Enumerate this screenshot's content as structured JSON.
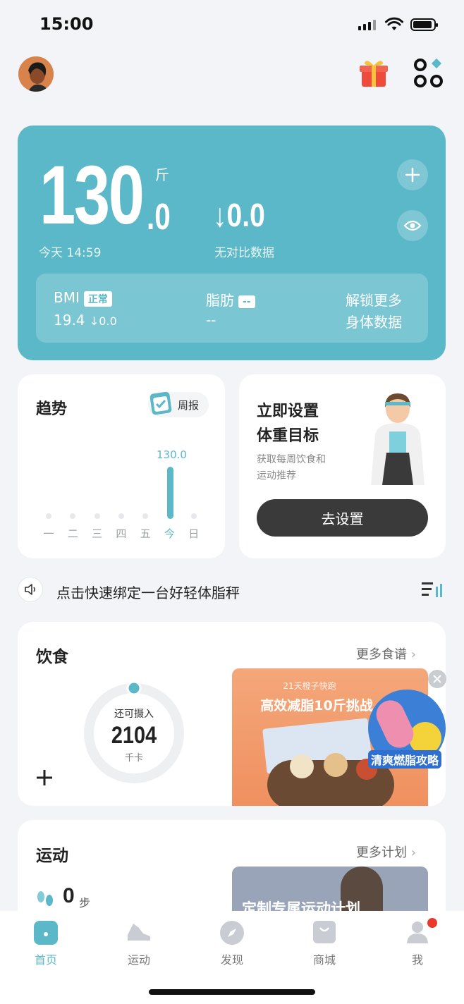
{
  "status": {
    "time": "15:00"
  },
  "weight": {
    "integer": "130",
    "decimal": ".0",
    "unit": "斤",
    "time": "今天 14:59",
    "diff": "↓0.0",
    "diff_label": "无对比数据"
  },
  "body_stats": {
    "bmi_label": "BMI",
    "bmi_badge": "正常",
    "bmi_value": "19.4",
    "bmi_diff": "↓0.0",
    "fat_label": "脂肪",
    "fat_badge": "--",
    "fat_value": "--",
    "unlock_line1": "解锁更多",
    "unlock_line2": "身体数据"
  },
  "trend": {
    "title": "趋势",
    "report": "周报",
    "value_label": "130.0",
    "days": [
      "一",
      "二",
      "三",
      "四",
      "五",
      "今",
      "日"
    ]
  },
  "goal": {
    "title_line1": "立即设置",
    "title_line2": "体重目标",
    "sub_line1": "获取每周饮食和",
    "sub_line2": "运动推荐",
    "button": "去设置"
  },
  "scale_tip": "点击快速绑定一台好轻体脂秤",
  "diet": {
    "title": "饮食",
    "more": "更多食谱",
    "ring_label": "还可摄入",
    "ring_value": "2104",
    "ring_unit": "千卡",
    "banner_top": "21天橙子快跑",
    "banner_title": "高效减脂10斤挑战",
    "banner_badge": "清爽燃脂攻略",
    "progress": 0.0
  },
  "exercise": {
    "title": "运动",
    "more": "更多计划",
    "steps": "0",
    "steps_unit": "步",
    "banner_title": "定制专属运动计划"
  },
  "nav": [
    {
      "label": "首页",
      "active": true
    },
    {
      "label": "运动",
      "active": false
    },
    {
      "label": "发现",
      "active": false
    },
    {
      "label": "商城",
      "active": false
    },
    {
      "label": "我",
      "active": false
    }
  ],
  "colors": {
    "accent": "#5bb8c8",
    "dark_button": "#3a3a3a",
    "badge_red": "#e8392b"
  },
  "icons": [
    "gift-icon",
    "apps-icon",
    "plus-icon",
    "eye-icon",
    "calendar-icon",
    "speaker-icon",
    "sort-icon",
    "close-icon",
    "footsteps-icon",
    "home-icon",
    "sneaker-icon",
    "compass-icon",
    "bag-icon",
    "user-icon"
  ]
}
